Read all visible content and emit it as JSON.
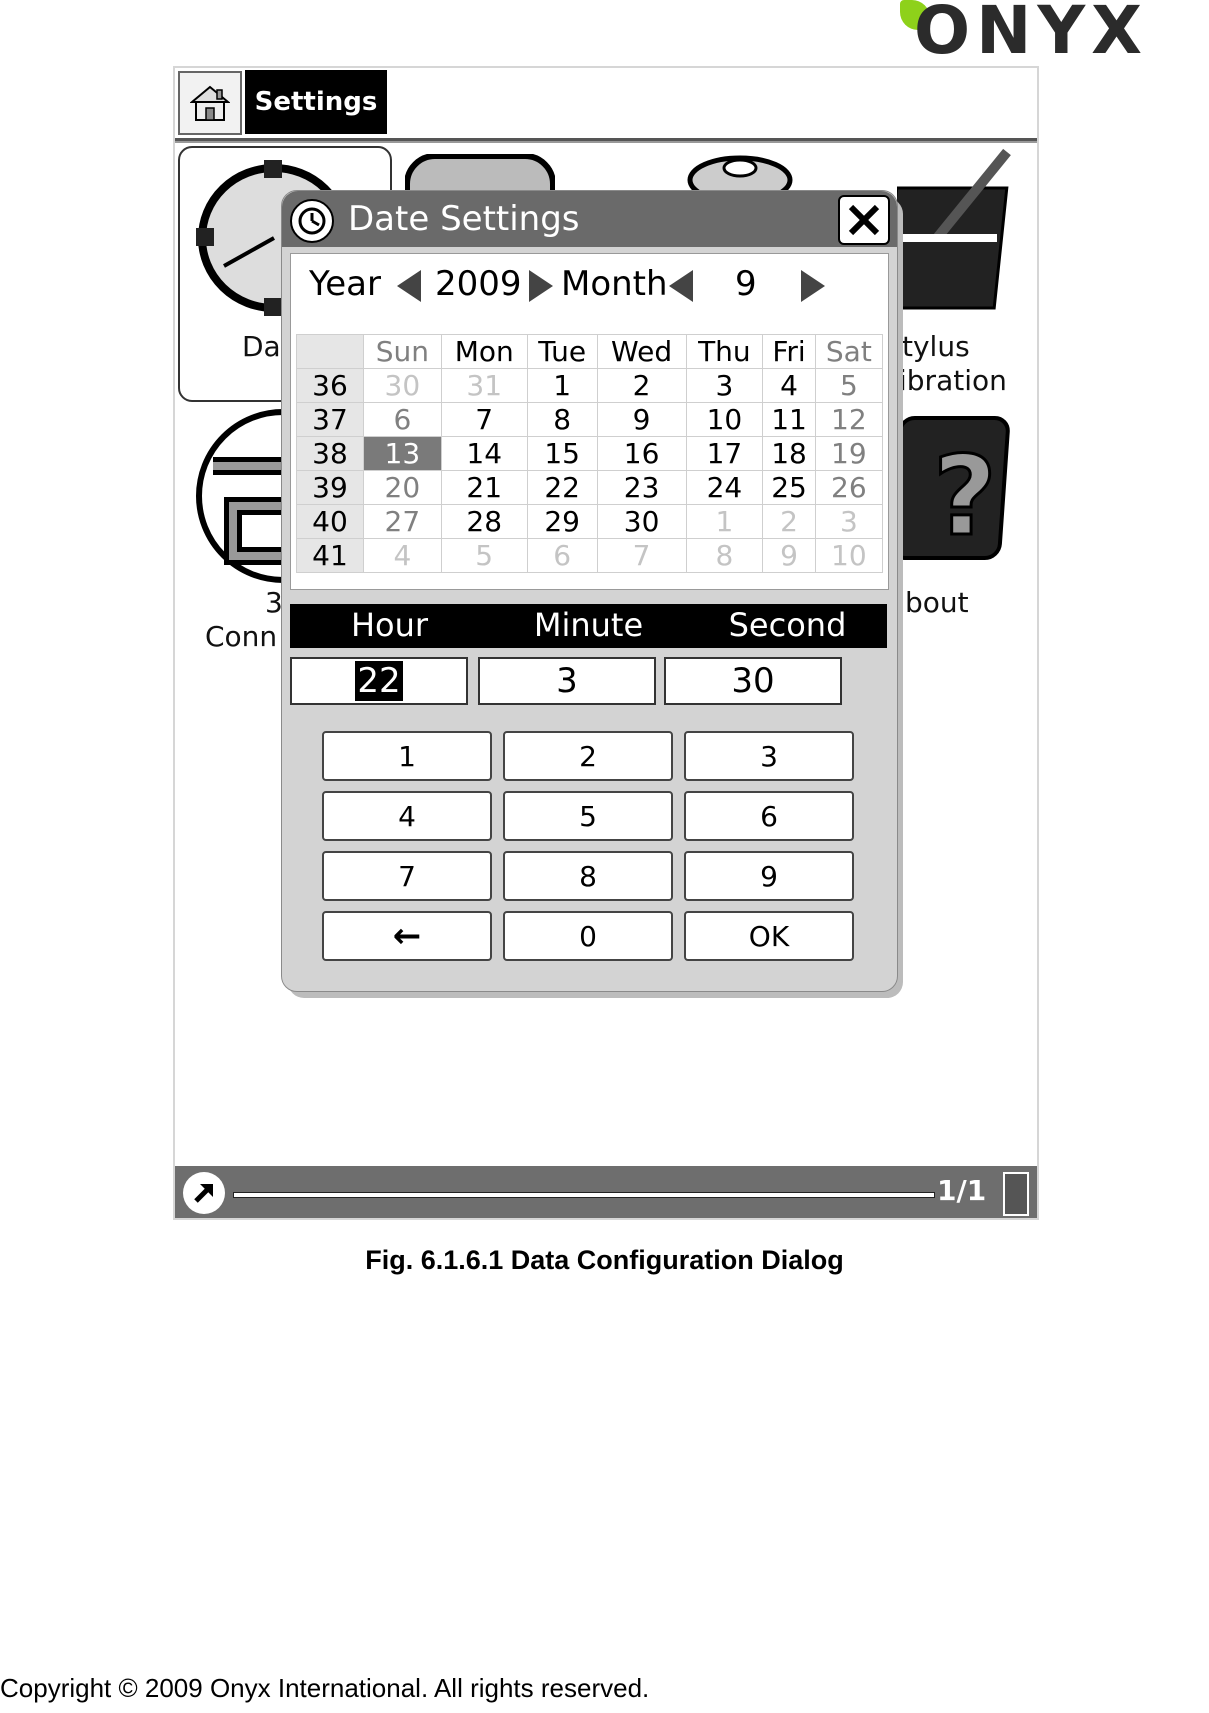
{
  "brand": {
    "logo_text": "ONYX",
    "logo_color": "#8ed11a"
  },
  "app": {
    "tab_title": "Settings"
  },
  "background_tiles": {
    "date_label": "Da",
    "stylus_label_1": "tylus",
    "stylus_label_2": "ibration",
    "conn_label_1": "3",
    "conn_label_2": "Conn",
    "about_label": "bout"
  },
  "dialog": {
    "title": "Date Settings",
    "year_label": "Year",
    "year_value": "2009",
    "month_label": "Month",
    "month_value": "9",
    "weekdays": [
      "Sun",
      "Mon",
      "Tue",
      "Wed",
      "Thu",
      "Fri",
      "Sat"
    ],
    "weeks": [
      {
        "week": "36",
        "days": [
          "30",
          "31",
          "1",
          "2",
          "3",
          "4",
          "5"
        ]
      },
      {
        "week": "37",
        "days": [
          "6",
          "7",
          "8",
          "9",
          "10",
          "11",
          "12"
        ]
      },
      {
        "week": "38",
        "days": [
          "13",
          "14",
          "15",
          "16",
          "17",
          "18",
          "19"
        ]
      },
      {
        "week": "39",
        "days": [
          "20",
          "21",
          "22",
          "23",
          "24",
          "25",
          "26"
        ]
      },
      {
        "week": "40",
        "days": [
          "27",
          "28",
          "29",
          "30",
          "1",
          "2",
          "3"
        ]
      },
      {
        "week": "41",
        "days": [
          "4",
          "5",
          "6",
          "7",
          "8",
          "9",
          "10"
        ]
      }
    ],
    "selected_day": "13",
    "time_headers": {
      "hour": "Hour",
      "minute": "Minute",
      "second": "Second"
    },
    "time_values": {
      "hour": "22",
      "minute": "3",
      "second": "30"
    },
    "keypad": [
      "1",
      "2",
      "3",
      "4",
      "5",
      "6",
      "7",
      "8",
      "9",
      "←",
      "0",
      "OK"
    ]
  },
  "status_bar": {
    "page": "1/1"
  },
  "caption": "Fig. 6.1.6.1 Data Configuration Dialog",
  "copyright": "Copyright © 2009 Onyx International. All rights reserved."
}
